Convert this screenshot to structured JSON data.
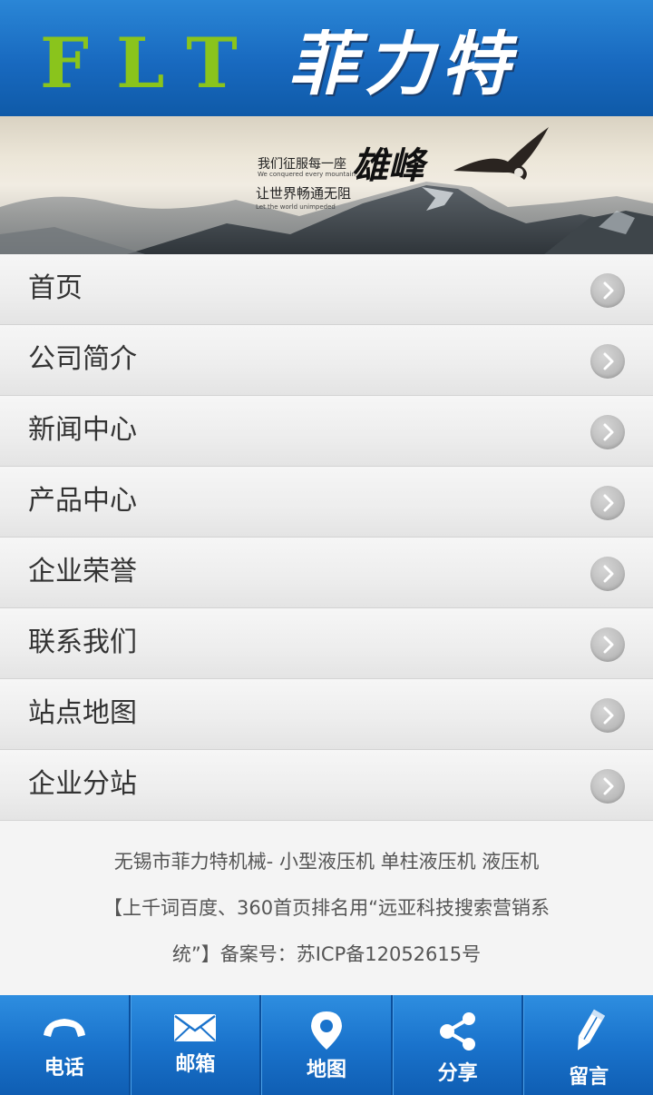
{
  "header": {
    "logo_en": "FLT",
    "logo_cn": "菲力特"
  },
  "banner": {
    "line1": "我们征服每一座",
    "line1_en": "We conquered every mountain",
    "big": "雄峰",
    "line2": "让世界畅通无阻",
    "line2_en": "Let the world unimpeded"
  },
  "menu": {
    "items": [
      {
        "label": "首页"
      },
      {
        "label": "公司简介"
      },
      {
        "label": "新闻中心"
      },
      {
        "label": "产品中心"
      },
      {
        "label": "企业荣誉"
      },
      {
        "label": "联系我们"
      },
      {
        "label": "站点地图"
      },
      {
        "label": "企业分站"
      }
    ]
  },
  "footer": {
    "line1": "无锡市菲力特机械- 小型液压机 单柱液压机 液压机",
    "line2": "【上千词百度、360首页排名用“远亚科技搜索营销系",
    "line3": "统”】备案号：苏ICP备12052615号"
  },
  "bottombar": {
    "tabs": [
      {
        "label": "电话",
        "icon": "phone-icon"
      },
      {
        "label": "邮箱",
        "icon": "mail-icon"
      },
      {
        "label": "地图",
        "icon": "map-pin-icon"
      },
      {
        "label": "分享",
        "icon": "share-icon"
      },
      {
        "label": "留言",
        "icon": "pencil-icon"
      }
    ]
  },
  "colors": {
    "header_blue": "#1869bf",
    "logo_green": "#8ac41c",
    "bar_blue": "#1a73cc"
  }
}
